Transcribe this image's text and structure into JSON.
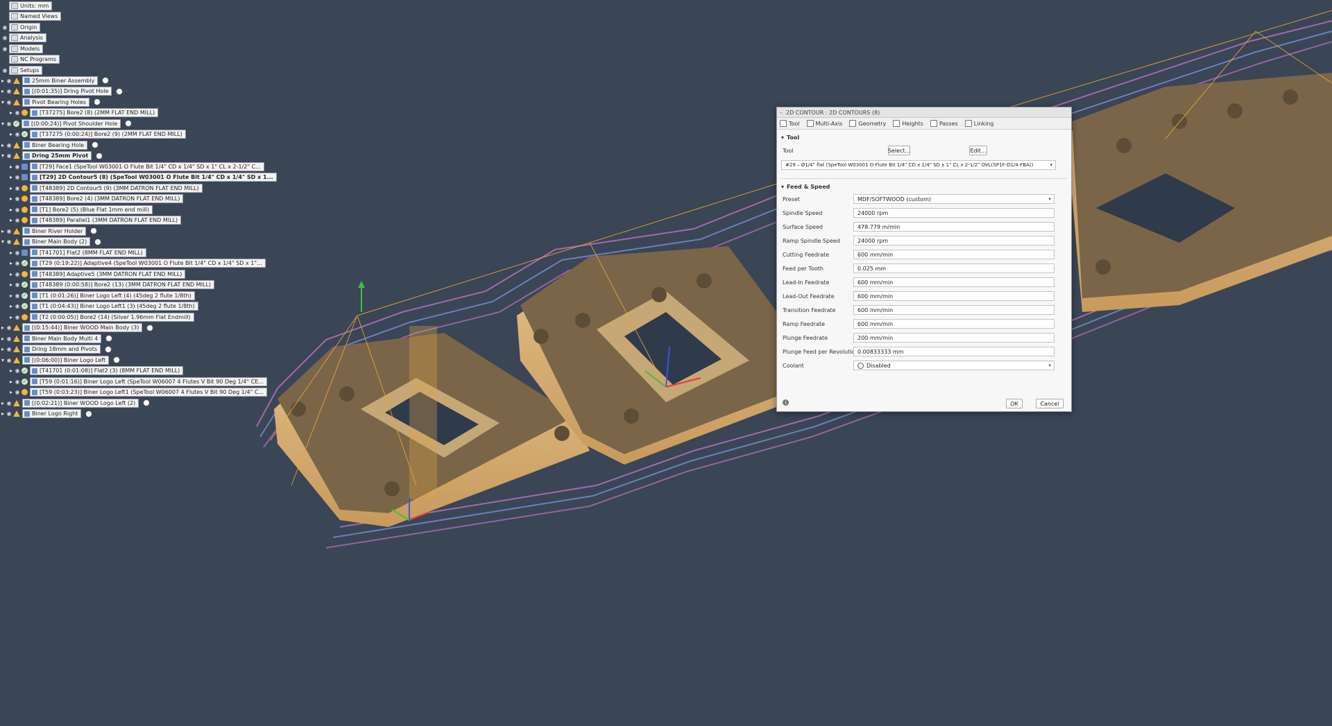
{
  "browser": {
    "top_items": [
      {
        "label": "Units: mm",
        "icon": "document-icon",
        "eye": false
      },
      {
        "label": "Named Views",
        "icon": "folder-icon",
        "eye": false
      },
      {
        "label": "Origin",
        "icon": "folder-icon",
        "eye": true
      },
      {
        "label": "Analysis",
        "icon": "folder-icon",
        "eye": true
      },
      {
        "label": "Models",
        "icon": "folder-icon",
        "eye": true
      },
      {
        "label": "NC Programs",
        "icon": "folder-icon",
        "eye": false
      },
      {
        "label": "Setups",
        "icon": "folder-icon",
        "eye": true
      }
    ],
    "ops": [
      {
        "level": 0,
        "expand": "▸",
        "status": "setup",
        "label": "25mm Biner Assembly",
        "bold": false,
        "circle": true
      },
      {
        "level": 0,
        "expand": "▸",
        "status": "setup",
        "label": "[(0:01:35)] Dring Pivot Hole",
        "bold": false,
        "circle": true
      },
      {
        "level": 0,
        "expand": "▾",
        "status": "setup",
        "label": "Pivot Bearing Holes",
        "bold": false,
        "circle": true
      },
      {
        "level": 1,
        "expand": "▸",
        "status": "warn",
        "label": "[T37275] Bore2 (8) (2MM FLAT END MILL)",
        "bold": false,
        "circle": false
      },
      {
        "level": 0,
        "expand": "▾",
        "status": "ok",
        "label": "[(0:00:24)] Pivot Shoulder Hole",
        "bold": false,
        "circle": true
      },
      {
        "level": 1,
        "expand": "▸",
        "status": "ok",
        "label": "[T37275 (0:00:24)] Bore2 (9) (2MM FLAT END MILL)",
        "bold": false,
        "circle": false
      },
      {
        "level": 0,
        "expand": "▸",
        "status": "setup",
        "label": "Biner Bearing Hole",
        "bold": false,
        "circle": true
      },
      {
        "level": 0,
        "expand": "▾",
        "status": "setup",
        "label": "Dring 25mm Pivot",
        "bold": true,
        "circle": true
      },
      {
        "level": 1,
        "expand": "▸",
        "status": "op",
        "label": "[T29] Face1 (SpeTool W03001 O Flute Bit 1/4\" CD x 1/4\" SD x 1\" CL x 2-1/2\" C...",
        "bold": false,
        "circle": false
      },
      {
        "level": 1,
        "expand": "▸",
        "status": "op",
        "label": "[T29] 2D Contour5 (8) (SpeTool W03001 O Flute Bit 1/4\" CD x 1/4\" SD x 1...",
        "bold": true,
        "circle": false
      },
      {
        "level": 1,
        "expand": "▸",
        "status": "warn",
        "label": "[T48389] 2D Contour5 (9) (3MM DATRON FLAT END MILL)",
        "bold": false,
        "circle": false
      },
      {
        "level": 1,
        "expand": "▸",
        "status": "warn",
        "label": "[T48389] Bore2 (4) (3MM DATRON FLAT END MILL)",
        "bold": false,
        "circle": false
      },
      {
        "level": 1,
        "expand": "▸",
        "status": "warn",
        "label": "[T1] Bore2 (5) (Blue Flat 1mm end mill)",
        "bold": false,
        "circle": false
      },
      {
        "level": 1,
        "expand": "▸",
        "status": "warn",
        "label": "[T48389] Parallel1 (3MM DATRON FLAT END MILL)",
        "bold": false,
        "circle": false
      },
      {
        "level": 0,
        "expand": "▸",
        "status": "setup",
        "label": "Biner River Holder",
        "bold": false,
        "circle": true
      },
      {
        "level": 0,
        "expand": "▾",
        "status": "setup",
        "label": "Biner Main Body (2)",
        "bold": false,
        "circle": true
      },
      {
        "level": 1,
        "expand": "▸",
        "status": "op",
        "label": "[T41701] Flat2 (8MM FLAT END MILL)",
        "bold": false,
        "circle": false
      },
      {
        "level": 1,
        "expand": "▸",
        "status": "ok",
        "label": "[T29 (0:19:22)] Adaptive4 (SpeTool W03001 O Flute Bit 1/4\" CD x 1/4\" SD x 1\"...",
        "bold": false,
        "circle": false
      },
      {
        "level": 1,
        "expand": "▸",
        "status": "warn",
        "label": "[T48389] Adaptive5 (3MM DATRON FLAT END MILL)",
        "bold": false,
        "circle": false
      },
      {
        "level": 1,
        "expand": "▸",
        "status": "ok",
        "label": "[T48389 (0:00:58)] Bore2 (13) (3MM DATRON FLAT END MILL)",
        "bold": false,
        "circle": false
      },
      {
        "level": 1,
        "expand": "▸",
        "status": "ok",
        "label": "[T1 (0:01:26)] Biner Logo Left (4) (45deg 2 flute 1/8th)",
        "bold": false,
        "circle": false
      },
      {
        "level": 1,
        "expand": "▸",
        "status": "ok",
        "label": "[T1 (0:04:43)] Biner Logo Left1 (3) (45deg 2 flute 1/8th)",
        "bold": false,
        "circle": false
      },
      {
        "level": 1,
        "expand": "▸",
        "status": "warn",
        "label": "[T2 (0:00:05)] Bore2 (14) (Silver 1.96mm Flat Endmill)",
        "bold": false,
        "circle": false
      },
      {
        "level": 0,
        "expand": "▸",
        "status": "setup",
        "label": "[(0:15:44)] Biner WOOD Main Body (3)",
        "bold": false,
        "circle": true
      },
      {
        "level": 0,
        "expand": "▸",
        "status": "setup",
        "label": "Biner Main Body Multi 4",
        "bold": false,
        "circle": true
      },
      {
        "level": 0,
        "expand": "▸",
        "status": "setup",
        "label": "Dring 18mm and Pivots",
        "bold": false,
        "circle": true
      },
      {
        "level": 0,
        "expand": "▾",
        "status": "setup",
        "label": "[(0:06:00)] Biner Logo Left",
        "bold": false,
        "circle": true
      },
      {
        "level": 1,
        "expand": "▸",
        "status": "ok",
        "label": "[T41701 (0:01:08)] Flat2 (3) (8MM FLAT END MILL)",
        "bold": false,
        "circle": false
      },
      {
        "level": 1,
        "expand": "▸",
        "status": "ok",
        "label": "[T59 (0:01:16)] Biner Logo Left (SpeTool W06007 4 Flutes V Bit 90 Deg 1/4\" CE...",
        "bold": false,
        "circle": false
      },
      {
        "level": 1,
        "expand": "▸",
        "status": "warn",
        "label": "[T59 (0:03:23)] Biner Logo Left1 (SpeTool W06007 4 Flutes V Bit 90 Deg 1/4\" C...",
        "bold": false,
        "circle": false
      },
      {
        "level": 0,
        "expand": "▸",
        "status": "setup",
        "label": "[(0:02:21)] Biner WOOD Logo Left (2)",
        "bold": false,
        "circle": true
      },
      {
        "level": 0,
        "expand": "▸",
        "status": "setup",
        "label": "Biner Logo Right",
        "bold": false,
        "circle": true
      }
    ]
  },
  "dialog": {
    "title": "2D CONTOUR : 2D CONTOURS (8)",
    "tabs": [
      "Tool",
      "Multi-Axis",
      "Geometry",
      "Heights",
      "Passes",
      "Linking"
    ],
    "tool_section": "Tool",
    "tool_label": "Tool",
    "select_btn": "Select...",
    "edit_btn": "Edit...",
    "tool_value": "#29 – Ø1/4\" flat (SpeTool W03001 O Flute Bit 1/4\" CD x 1/4\" SD x 1\" CL x 2-1/2\" OVL(SP1F-D1/4-FBA))",
    "feed_section": "Feed & Speed",
    "fields": [
      {
        "label": "Preset",
        "value": "MDF/SOFTWOOD (custom)",
        "dropdown": true
      },
      {
        "label": "Spindle Speed",
        "value": "24000 rpm",
        "dropdown": false
      },
      {
        "label": "Surface Speed",
        "value": "478.779 m/min",
        "dropdown": false
      },
      {
        "label": "Ramp Spindle Speed",
        "value": "24000 rpm",
        "dropdown": false
      },
      {
        "label": "Cutting Feedrate",
        "value": "600 mm/min",
        "dropdown": false
      },
      {
        "label": "Feed per Tooth",
        "value": "0.025 mm",
        "dropdown": false
      },
      {
        "label": "Lead-In Feedrate",
        "value": "600 mm/min",
        "dropdown": false
      },
      {
        "label": "Lead-Out Feedrate",
        "value": "600 mm/min",
        "dropdown": false
      },
      {
        "label": "Transition Feedrate",
        "value": "600 mm/min",
        "dropdown": false
      },
      {
        "label": "Ramp Feedrate",
        "value": "600 mm/min",
        "dropdown": false
      },
      {
        "label": "Plunge Feedrate",
        "value": "200 mm/min",
        "dropdown": false
      },
      {
        "label": "Plunge Feed per Revolution",
        "value": "0.00833333 mm",
        "dropdown": false
      },
      {
        "label": "Coolant",
        "value": "Disabled",
        "dropdown": true
      }
    ],
    "ok": "OK",
    "cancel": "Cancel"
  },
  "colors": {
    "background": "#3a4556",
    "wood": "#d7b27d",
    "wood_dark": "#7a6548",
    "toolpath": "#d97ab8",
    "link_lines": "#e8a23c"
  }
}
